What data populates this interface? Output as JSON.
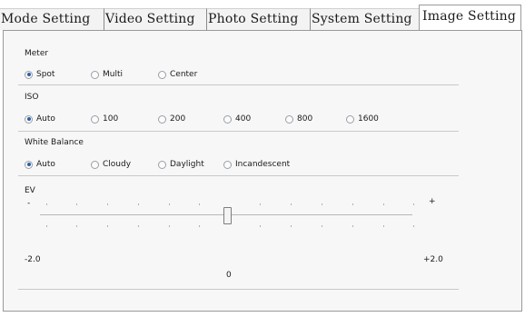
{
  "tabs": [
    {
      "label": "Mode Setting"
    },
    {
      "label": "Video Setting"
    },
    {
      "label": "Photo Setting"
    },
    {
      "label": "System Setting"
    },
    {
      "label": "Image Setting",
      "active": true
    }
  ],
  "meter": {
    "label": "Meter",
    "options": [
      "Spot",
      "Multi",
      "Center"
    ],
    "selected": "Spot"
  },
  "iso": {
    "label": "ISO",
    "options": [
      "Auto",
      "100",
      "200",
      "400",
      "800",
      "1600"
    ],
    "selected": "Auto"
  },
  "white_balance": {
    "label": "White Balance",
    "options": [
      "Auto",
      "Cloudy",
      "Daylight",
      "Incandescent"
    ],
    "selected": "Auto"
  },
  "ev": {
    "label": "EV",
    "minus_symbol": "-",
    "plus_symbol": "+",
    "min_label": "-2.0",
    "max_label": "+2.0",
    "value_label": "0",
    "value": 0,
    "min": -2.0,
    "max": 2.0
  }
}
